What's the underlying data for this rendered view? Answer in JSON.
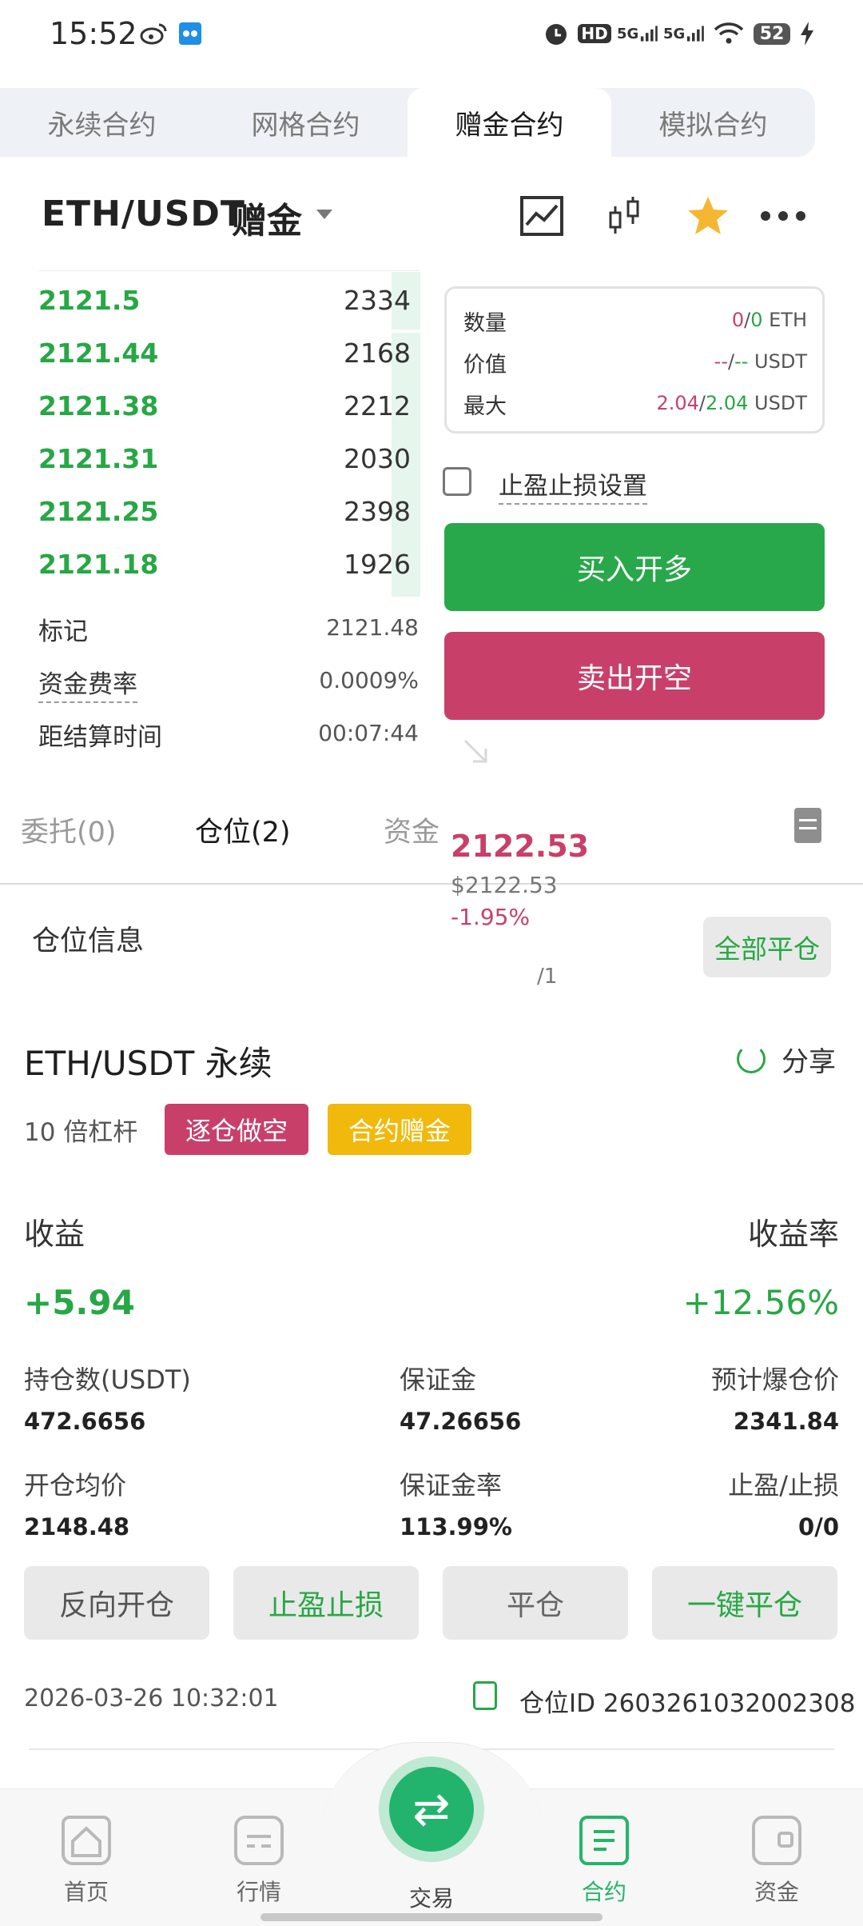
{
  "status_bar": {
    "time": "15:52",
    "icons": [
      "weibo-icon",
      "app-icon",
      "alarm-icon",
      "hd-icon",
      "signal-5g-icon",
      "signal-5g-icon",
      "wifi-icon",
      "battery-icon",
      "charging-icon"
    ],
    "hd": "HD",
    "net1": "5G",
    "net2": "5G",
    "battery": "52"
  },
  "tabs": [
    {
      "label": "永续合约",
      "active": false
    },
    {
      "label": "网格合约",
      "active": false
    },
    {
      "label": "赠金合约",
      "active": true
    },
    {
      "label": "模拟合约",
      "active": false
    }
  ],
  "header": {
    "pair": "ETH/USDT",
    "mode": "赠金",
    "icons": [
      "chart-line-icon",
      "candlestick-icon",
      "star-icon",
      "more-icon"
    ],
    "star_color": "#f5b731"
  },
  "orderbook": {
    "rows": [
      {
        "price": "2121.5",
        "qty": "2334"
      },
      {
        "price": "2121.44",
        "qty": "2168"
      },
      {
        "price": "2121.38",
        "qty": "2212"
      },
      {
        "price": "2121.31",
        "qty": "2030"
      },
      {
        "price": "2121.25",
        "qty": "2398"
      },
      {
        "price": "2121.18",
        "qty": "1926"
      }
    ],
    "mark_label": "标记",
    "mark_value": "2121.48",
    "funding_label": "资金费率",
    "funding_value": "0.0009%",
    "settle_label": "距结算时间",
    "settle_value": "00:07:44"
  },
  "order_panel": {
    "qty_label": "数量",
    "qty_a": "0",
    "qty_b": "0",
    "qty_unit": "ETH",
    "value_label": "价值",
    "value_a": "--",
    "value_b": "--",
    "value_unit": "USDT",
    "max_label": "最大",
    "max_a": "2.04",
    "max_b": "2.04",
    "max_unit": "USDT",
    "tpsl_label": "止盈止损设置",
    "buy_label": "买入开多",
    "sell_label": "卖出开空",
    "buy_color": "#28a84a",
    "sell_color": "#c8406a"
  },
  "section_tabs": [
    {
      "label": "委托(0)",
      "active": false
    },
    {
      "label": "仓位(2)",
      "active": true
    },
    {
      "label": "资金",
      "active": false
    }
  ],
  "floating_price": {
    "price": "2122.53",
    "usd": "$2122.53",
    "change": "-1.95%",
    "page": "/1"
  },
  "position": {
    "section_title": "仓位信息",
    "close_all": "全部平仓",
    "pair": "ETH/USDT 永续",
    "share": "分享",
    "leverage": "10 倍杠杆",
    "badge_short": "逐仓做空",
    "badge_bonus": "合约赠金",
    "pnl_label": "收益",
    "pnl_value": "+5.94",
    "roe_label": "收益率",
    "roe_value": "+12.56%",
    "size_label": "持仓数(USDT)",
    "size_value": "472.6656",
    "margin_label": "保证金",
    "margin_value": "47.26656",
    "liq_label": "预计爆仓价",
    "liq_value": "2341.84",
    "entry_label": "开仓均价",
    "entry_value": "2148.48",
    "margin_rate_label": "保证金率",
    "margin_rate_value": "113.99%",
    "tpsl_label": "止盈/止损",
    "tpsl_value": "0/0",
    "actions": [
      "反向开仓",
      "止盈止损",
      "平仓",
      "一键平仓"
    ],
    "timestamp": "2026-03-26 10:32:01",
    "position_id": "仓位ID 2603261032002308"
  },
  "bottom_nav": {
    "items": [
      {
        "label": "首页",
        "icon": "home-icon",
        "active": false
      },
      {
        "label": "行情",
        "icon": "market-icon",
        "active": false
      },
      {
        "label": "交易",
        "icon": "swap-icon",
        "active": false
      },
      {
        "label": "合约",
        "icon": "contract-icon",
        "active": true
      },
      {
        "label": "资金",
        "icon": "wallet-icon",
        "active": false
      }
    ],
    "trade_glyph": "⇄",
    "accent": "#22b46c"
  }
}
